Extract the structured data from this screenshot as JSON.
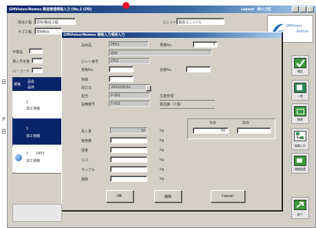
{
  "main_window": {
    "title": "GMVision/Nomos 製造管理規格入力 [No.2 LTD]",
    "title_right": "Layout　新入力区",
    "header": {
      "label1": "製造工程",
      "value1": "原材/製造工程",
      "label2": "サブ工程",
      "value2": "原材料A",
      "label3": "ユニット",
      "value3": "製造ユニット1"
    },
    "left_labels": [
      "作業品",
      "挿入予定量",
      "バーコード"
    ],
    "table_header": [
      "規格",
      "品名",
      "品目"
    ],
    "rows": [
      {
        "num": "1",
        "status": "加工待機"
      },
      {
        "num": "1",
        "status": "加工待機"
      },
      {
        "num": "1",
        "status": "加工待機",
        "extra": "1901"
      }
    ]
  },
  "logo": {
    "line1": "GMVision",
    "line2": "Nomos"
  },
  "sidebar": [
    {
      "id": "check",
      "caption": "確定"
    },
    {
      "id": "doc",
      "caption": "一覧"
    },
    {
      "id": "sheet",
      "caption": "帳票"
    },
    {
      "id": "tree",
      "caption": "展開入力"
    },
    {
      "id": "report",
      "caption": "規格配置"
    },
    {
      "id": "exit",
      "caption": "終了"
    }
  ],
  "dialog": {
    "title": "GMVision/Nomos 規格入力項目入力",
    "labels": {
      "hinban": "品目品",
      "hinmei": "品名",
      "lot": "ロット番号",
      "kikaku": "規格No.",
      "yoryo": "容量No.",
      "saiban": "採番",
      "jidai": "改訂日",
      "tanto": "担当",
      "setubi": "設備番号",
      "bunrui": "分類"
    },
    "values": {
      "hinban": "PE01",
      "hinmei": "原料",
      "lot": "LT01",
      "jidai": "2001/06/01",
      "tanto": "P-001",
      "setubi": "T-001",
      "tanto_name": "生産管理",
      "setubi_name": "製造課（工程）",
      "kikaku_r": "3"
    },
    "amount_labels": [
      "投入量",
      "使用量",
      "残量",
      "ロス",
      "サンプル",
      "端数"
    ],
    "amount_value": "50",
    "unit": "kg",
    "today_label": "今日",
    "before_label": "前日",
    "today_value": "50",
    "buttons": {
      "ok": "OK",
      "delete": "削除",
      "cancel": "Cancel"
    }
  },
  "caption_chars": [
    "日",
    "ド",
    "日"
  ]
}
